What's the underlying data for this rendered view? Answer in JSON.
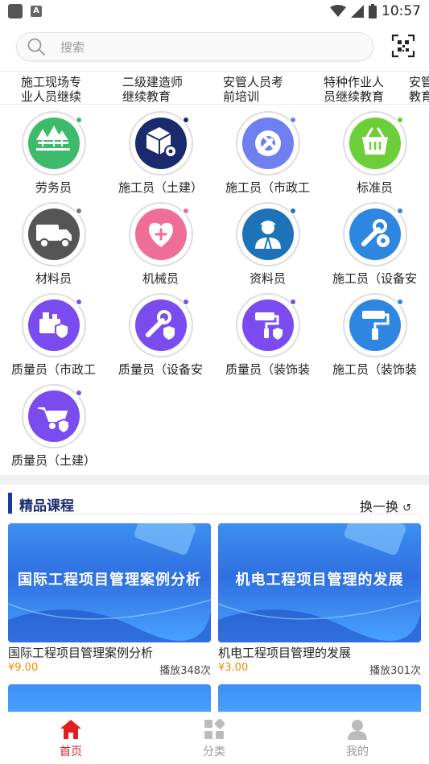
{
  "status_bar": {
    "time": "10:57",
    "a_badge": "A"
  },
  "search": {
    "placeholder": "搜索"
  },
  "tabs": [
    "施工现场专\n业人员继续",
    "二级建造师\n继续教育",
    "安管人员考\n前培训",
    "特种作业人\n员继续教育",
    "安管\n教育"
  ],
  "grid": [
    {
      "label": "劳务员",
      "icon": "trees-icon",
      "color": "#3dba6a",
      "dot": "#3dba6a"
    },
    {
      "label": "施工员（土建）",
      "icon": "box-gear-icon",
      "color": "#1a2a6c",
      "dot": "#1a2a6c"
    },
    {
      "label": "施工员（市政工",
      "icon": "tools-gear-icon",
      "color": "#6e7ff0",
      "dot": "#6e7ff0"
    },
    {
      "label": "标准员",
      "icon": "basket-icon",
      "color": "#6ccf3a",
      "dot": "#6ccf3a"
    },
    {
      "label": "材料员",
      "icon": "truck-icon",
      "color": "#555555",
      "dot": "#777777"
    },
    {
      "label": "机械员",
      "icon": "heart-plus-icon",
      "color": "#ee6e95",
      "dot": "#ee6e95"
    },
    {
      "label": "资料员",
      "icon": "worker-icon",
      "color": "#1e73b8",
      "dot": "#1e73b8"
    },
    {
      "label": "施工员（设备安",
      "icon": "wrench-gear-icon",
      "color": "#2f86e0",
      "dot": "#2f86e0"
    },
    {
      "label": "质量员（市政工",
      "icon": "machine-shield-icon",
      "color": "#7a4cf0",
      "dot": "#7a4cf0"
    },
    {
      "label": "质量员（设备安",
      "icon": "wrench-shield-icon",
      "color": "#7a4cf0",
      "dot": "#7a4cf0"
    },
    {
      "label": "质量员（装饰装",
      "icon": "roller-shield-icon",
      "color": "#7a4cf0",
      "dot": "#7a4cf0"
    },
    {
      "label": "施工员（装饰装",
      "icon": "paint-roller-icon",
      "color": "#2f86e0",
      "dot": "#2f86e0"
    },
    {
      "label": "质量员（土建）",
      "icon": "wheelbarrow-shield-icon",
      "color": "#7a4cf0",
      "dot": "#7a4cf0"
    }
  ],
  "section": {
    "title": "精品课程",
    "refresh": "换一换"
  },
  "courses": [
    {
      "thumb_text": "国际工程项目管理案例分析",
      "title": "国际工程项目管理案例分析",
      "price": "¥9.00",
      "plays": "播放348次"
    },
    {
      "thumb_text": "机电工程项目管理的发展",
      "title": "机电工程项目管理的发展",
      "price": "¥3.00",
      "plays": "播放301次"
    }
  ],
  "nav": [
    {
      "label": "首页",
      "icon": "home-icon",
      "active": true
    },
    {
      "label": "分类",
      "icon": "category-icon",
      "active": false
    },
    {
      "label": "我的",
      "icon": "profile-icon",
      "active": false
    }
  ],
  "colors": {
    "accent": "#e02020",
    "nav_inactive": "#aaaaaa",
    "brand_dark": "#1a3b9c"
  }
}
